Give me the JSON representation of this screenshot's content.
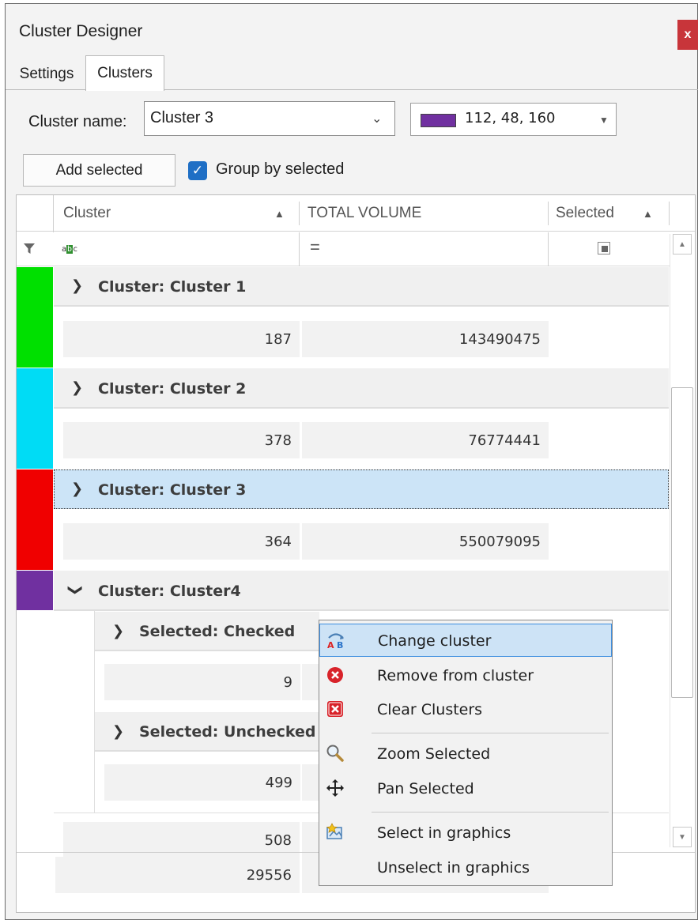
{
  "window": {
    "title": "Cluster Designer",
    "close_label": "x"
  },
  "tabs": [
    "Settings",
    "Clusters"
  ],
  "form": {
    "cluster_name_label": "Cluster name:",
    "cluster_name_value": "Cluster 3",
    "color_text": "112, 48, 160",
    "color_hex": "#7030a0",
    "add_selected_label": "Add selected",
    "group_by_label": "Group by selected",
    "group_by_checked": true
  },
  "grid": {
    "columns": [
      "Cluster",
      "TOTAL VOLUME",
      "Selected"
    ],
    "filter_equals": "=",
    "groups": [
      {
        "label": "Cluster: Cluster 1",
        "color": "#00e000",
        "count": "187",
        "volume": "143490475"
      },
      {
        "label": "Cluster: Cluster 2",
        "color": "#00dcf5",
        "count": "378",
        "volume": "76774441"
      },
      {
        "label": "Cluster: Cluster 3",
        "color": "#f00000",
        "count": "364",
        "volume": "550079095"
      },
      {
        "label": "Cluster: Cluster4",
        "color": "#7030a0"
      }
    ],
    "subgroups": [
      {
        "label": "Selected: Checked",
        "count": "9"
      },
      {
        "label": "Selected: Unchecked",
        "count": "499"
      }
    ],
    "cluster4_total": "508",
    "grand_total": "29556"
  },
  "context_menu": {
    "items": [
      {
        "label": "Change cluster",
        "icon": "change-cluster-icon"
      },
      {
        "label": "Remove from cluster",
        "icon": "remove-icon"
      },
      {
        "label": "Clear Clusters",
        "icon": "clear-clusters-icon"
      },
      {
        "label": "Zoom Selected",
        "icon": "zoom-icon"
      },
      {
        "label": "Pan Selected",
        "icon": "pan-icon"
      },
      {
        "label": "Select in graphics",
        "icon": "select-graphics-icon"
      },
      {
        "label": "Unselect in graphics",
        "icon": ""
      }
    ]
  }
}
